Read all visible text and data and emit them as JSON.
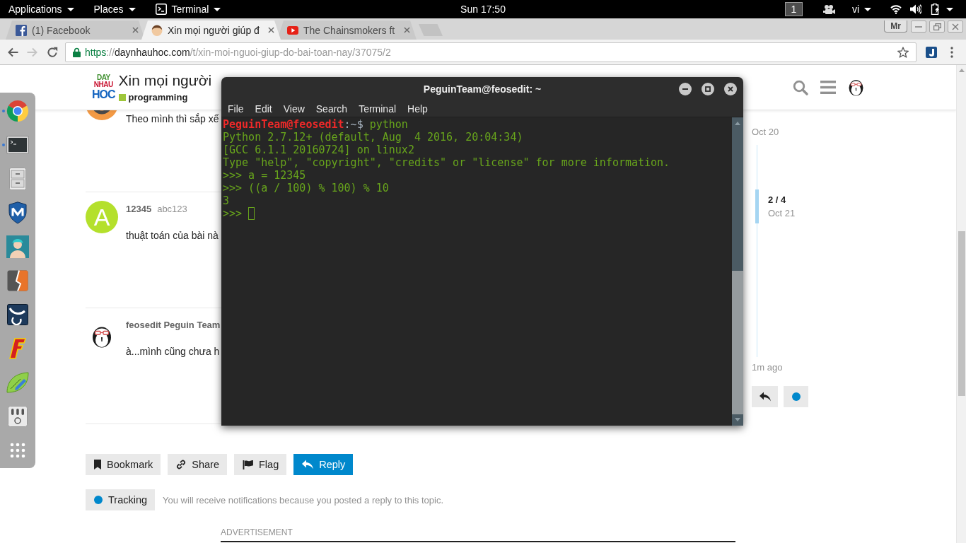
{
  "top_bar": {
    "menus": [
      {
        "kind": "text",
        "label": "Applications"
      },
      {
        "kind": "text",
        "label": "Places"
      },
      {
        "kind": "app",
        "label": "Terminal"
      }
    ],
    "clock": "Sun 17:50",
    "workspace": "1",
    "keyboard_layout": "vi"
  },
  "browser": {
    "tabs": [
      {
        "kind": "social",
        "title": "(1) Facebook",
        "selected": false
      },
      {
        "kind": "forum",
        "title": "Xin mọi người giúp đ",
        "selected": true
      },
      {
        "kind": "video",
        "title": "The Chainsmokers ft",
        "selected": false
      }
    ],
    "profile": "Mr",
    "navigation": {
      "back_disabled": false,
      "forward_disabled": true
    },
    "url": {
      "scheme": "https",
      "separator": "://",
      "host": "daynhauhoc.com",
      "path": "/t/xin-moi-nguoi-giup-do-bai-toan-nay/37075/2"
    }
  },
  "dock": {
    "items": [
      {
        "kind": "browser",
        "running": true
      },
      {
        "kind": "terminal",
        "running": true
      },
      {
        "kind": "files",
        "running": false
      },
      {
        "kind": "shield",
        "running": false
      },
      {
        "kind": "person-tile",
        "running": false
      },
      {
        "kind": "zigzag-tile",
        "running": false
      },
      {
        "kind": "horns-tile",
        "running": false
      },
      {
        "kind": "f-logo",
        "running": false
      },
      {
        "kind": "leaf-pencil",
        "running": false
      },
      {
        "kind": "mixer",
        "running": false
      },
      {
        "kind": "app-grid",
        "running": false
      }
    ]
  },
  "forum": {
    "logo": [
      "DAY",
      "NHAU",
      "HOC"
    ],
    "title": "Xin mọi người",
    "category": "programming",
    "posts": [
      {
        "avatar": {
          "kind": "ring",
          "color": "#f39a45"
        },
        "body": "Theo mình thì sắp xế"
      },
      {
        "avatar": {
          "kind": "letter",
          "letter": "A",
          "color": "#b4e02c"
        },
        "username": "12345",
        "name": "abc123",
        "body": "thuật toán của bài nà"
      },
      {
        "avatar": {
          "kind": "penguin"
        },
        "username": "feosedit Peguin Team",
        "body": "à...mình cũng chưa h"
      }
    ],
    "actions": [
      {
        "kind": "bookmark",
        "label": "Bookmark",
        "primary": false
      },
      {
        "kind": "share",
        "label": "Share",
        "primary": false
      },
      {
        "kind": "flag",
        "label": "Flag",
        "primary": false
      },
      {
        "kind": "reply",
        "label": "Reply",
        "primary": true
      }
    ],
    "tracking": {
      "label": "Tracking",
      "description": "You will receive notifications because you posted a reply to this topic."
    },
    "advertisement": "ADVERTISEMENT",
    "timeline": {
      "start": "Oct 20",
      "position": "2 / 4",
      "position_date": "Oct 21",
      "end": "1m ago"
    }
  },
  "terminal": {
    "title": "PeguinTeam@feosedit: ~",
    "menu": [
      "File",
      "Edit",
      "View",
      "Search",
      "Terminal",
      "Help"
    ],
    "lines": [
      {
        "kind": "prompt",
        "user": "PeguinTeam@feosedit",
        "path": ":~$",
        "command": "python"
      },
      {
        "kind": "output",
        "text": "Python 2.7.12+ (default, Aug  4 2016, 20:04:34)"
      },
      {
        "kind": "output",
        "text": "[GCC 6.1.1 20160724] on linux2"
      },
      {
        "kind": "output",
        "text": "Type \"help\", \"copyright\", \"credits\" or \"license\" for more information."
      },
      {
        "kind": "output",
        "text": ">>> a = 12345"
      },
      {
        "kind": "output",
        "text": ">>> ((a / 100) % 100) % 10"
      },
      {
        "kind": "output",
        "text": "3"
      },
      {
        "kind": "input",
        "text": ">>>"
      }
    ]
  }
}
